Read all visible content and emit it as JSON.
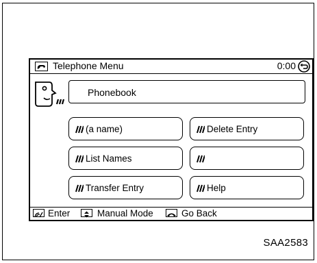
{
  "window": {
    "title": "Telephone Menu",
    "timer": "0:00",
    "title_icon": "phone-icon",
    "back_icon": "back-arrow-icon"
  },
  "phonebook": {
    "label": "Phonebook",
    "icon": "voice-recognition-face-icon"
  },
  "menu": {
    "voice_icon": "voice-command-icon",
    "items": [
      {
        "label": "(a name)"
      },
      {
        "label": "Delete Entry"
      },
      {
        "label": "List Names"
      },
      {
        "label": ""
      },
      {
        "label": "Transfer Entry"
      },
      {
        "label": "Help"
      }
    ]
  },
  "statusbar": {
    "enter_label": "Enter",
    "enter_icon": "talk-switch-icon",
    "manual_label": "Manual Mode",
    "manual_icon": "up-down-arrow-icon",
    "back_label": "Go Back",
    "back_icon": "hang-up-phone-icon"
  },
  "figure_code": "SAA2583"
}
